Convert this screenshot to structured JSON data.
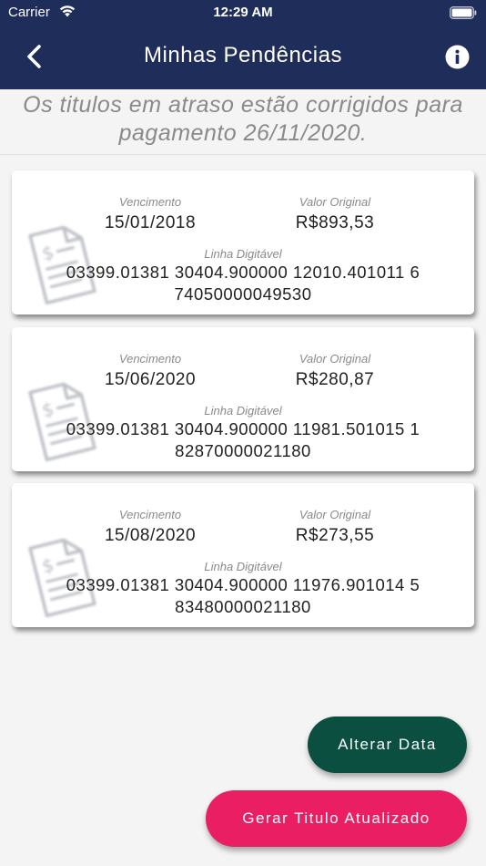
{
  "status": {
    "carrier": "Carrier",
    "time": "12:29 AM"
  },
  "nav": {
    "title": "Minhas Pendências",
    "back_icon": "chevron-left-icon",
    "info_icon": "info-icon"
  },
  "notice": "Os titulos em atraso estão corrigidos para pagamento 26/11/2020.",
  "labels": {
    "vencimento": "Vencimento",
    "valor_original": "Valor Original",
    "linha_digitavel": "Linha Digitável"
  },
  "items": [
    {
      "vencimento": "15/01/2018",
      "valor": "R$893,53",
      "linha": "03399.01381 30404.900000 12010.401011 6 74050000049530"
    },
    {
      "vencimento": "15/06/2020",
      "valor": "R$280,87",
      "linha": "03399.01381 30404.900000 11981.501015 1 82870000021180"
    },
    {
      "vencimento": "15/08/2020",
      "valor": "R$273,55",
      "linha": "03399.01381 30404.900000 11976.901014 5 83480000021180"
    }
  ],
  "buttons": {
    "alterar": "Alterar Data",
    "gerar": "Gerar Titulo Atualizado"
  },
  "colors": {
    "header": "#1f2d5a",
    "alterar": "#0a4f3f",
    "gerar": "#e91e63"
  }
}
